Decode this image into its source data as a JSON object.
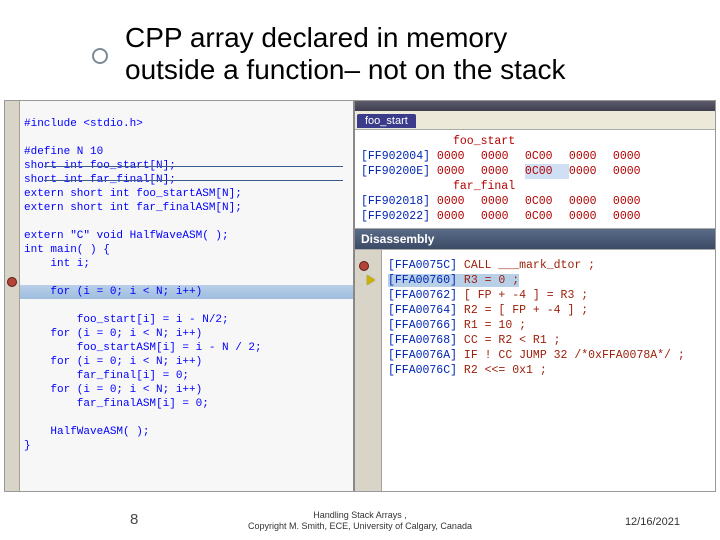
{
  "title_line1": "CPP array declared in memory",
  "title_line2": "outside a function– not on the stack",
  "code": {
    "l1": "#include <stdio.h>",
    "l2": "",
    "l3": "#define N 10",
    "l4": "short int foo_start[N];",
    "l5": "short int far_final[N];",
    "l6": "extern short int foo_startASM[N];",
    "l7": "extern short int far_finalASM[N];",
    "l8": "",
    "l9": "extern \"C\" void HalfWaveASM( );",
    "l10": "int main( ) {",
    "l11": "    int i;",
    "l12": "",
    "l13": "    for (i = 0; i < N; i++)",
    "l14": "        foo_start[i] = i - N/2;",
    "l15": "    for (i = 0; i < N; i++)",
    "l16": "        foo_startASM[i] = i - N / 2;",
    "l17": "    for (i = 0; i < N; i++)",
    "l18": "        far_final[i] = 0;",
    "l19": "    for (i = 0; i < N; i++)",
    "l20": "        far_finalASM[i] = 0;",
    "l21": "",
    "l22": "    HalfWaveASM( );",
    "l23": "}"
  },
  "mem_tab": "foo_start",
  "mem_label1": "foo_start",
  "mem_label2": "far_final",
  "mem": [
    {
      "addr": "[FF902004]",
      "v": [
        "0000",
        "0000",
        "0C00",
        "0000",
        "0000"
      ]
    },
    {
      "addr": "[FF90200E]",
      "v": [
        "0000",
        "0000",
        "0C00",
        "0000",
        "0000"
      ]
    },
    {
      "addr": "[FF902018]",
      "v": [
        "0000",
        "0000",
        "0C00",
        "0000",
        "0000"
      ]
    },
    {
      "addr": "[FF902022]",
      "v": [
        "0000",
        "0000",
        "0C00",
        "0000",
        "0000"
      ]
    }
  ],
  "disasm_title": "Disassembly",
  "disasm": [
    {
      "a": "[FFA0075C]",
      "t": "CALL ___mark_dtor ;"
    },
    {
      "a": "[FFA00760]",
      "t": "R3 = 0 ;",
      "hl": true
    },
    {
      "a": "[FFA00762]",
      "t": "[ FP + -4 ] = R3 ;"
    },
    {
      "a": "[FFA00764]",
      "t": "R2 = [ FP + -4 ] ;"
    },
    {
      "a": "[FFA00766]",
      "t": "R1 = 10 ;"
    },
    {
      "a": "[FFA00768]",
      "t": "CC = R2 < R1 ;"
    },
    {
      "a": "[FFA0076A]",
      "t": "IF ! CC JUMP 32 /*0xFFA0078A*/ ;"
    },
    {
      "a": "[FFA0076C]",
      "t": "R2 <<= 0x1 ;"
    }
  ],
  "footer": {
    "page": "8",
    "center1": "Handling Stack Arrays                               ,",
    "center2": "Copyright M. Smith, ECE, University of Calgary, Canada",
    "date": "12/16/2021"
  }
}
